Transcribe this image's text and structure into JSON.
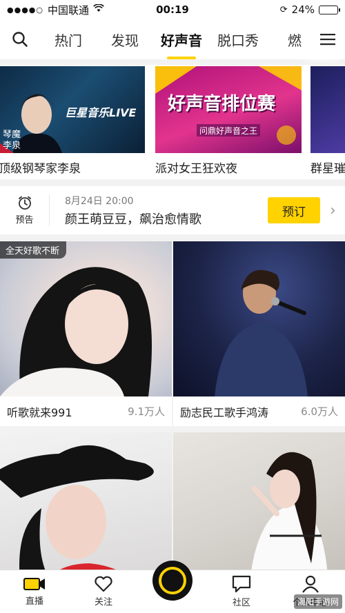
{
  "status_bar": {
    "signal": "●●●●○",
    "carrier": "中国联通",
    "wifi_icon": "wifi-icon",
    "time": "00:19",
    "battery_text": "24%",
    "battery_level": 0.24
  },
  "nav": {
    "tabs": [
      {
        "label": "热门"
      },
      {
        "label": "发现"
      },
      {
        "label": "好声音",
        "active": true
      },
      {
        "label": "脱口秀"
      },
      {
        "label": "燃"
      }
    ]
  },
  "banners": [
    {
      "caption": "顶级钢琴家李泉",
      "art_title": "巨星音乐LIVE",
      "art_sub": "琴魔 李泉"
    },
    {
      "caption": "派对女王狂欢夜",
      "art_title": "好声音排位赛",
      "art_sub": "问鼎好声音之王"
    },
    {
      "caption": "群星璀"
    }
  ],
  "reminder": {
    "label": "预告",
    "date": "8月24日 20:00",
    "title": "颜王萌豆豆，飙治愈情歌",
    "button": "预订"
  },
  "cards": [
    {
      "name": "听歌就来991",
      "count": "9.1万人",
      "tag": "全天好歌不断"
    },
    {
      "name": "励志民工歌手鸿涛",
      "count": "6.0万人"
    },
    {
      "name": "",
      "count": ""
    },
    {
      "name": "",
      "count": ""
    }
  ],
  "tabbar": {
    "items": [
      {
        "label": "直播"
      },
      {
        "label": "关注"
      },
      {
        "label": ""
      },
      {
        "label": "社区"
      },
      {
        "label": "个人中心"
      }
    ]
  },
  "watermark": "海阳手游网",
  "colors": {
    "accent": "#ffd200"
  }
}
